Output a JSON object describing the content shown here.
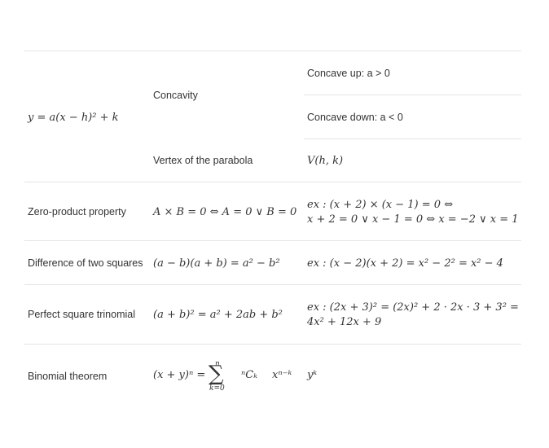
{
  "rows": {
    "vertex_form": {
      "label": "y = a(x − h)² + k",
      "concavity": {
        "label": "Concavity",
        "up": "Concave up: a > 0",
        "down": "Concave down: a < 0"
      },
      "vertex": {
        "label": "Vertex of the parabola",
        "value": "V(h, k)"
      }
    },
    "zero_product": {
      "label": "Zero-product property",
      "formula": "A × B = 0 ⇔ A = 0 ∨ B = 0",
      "example_line1": "ex : (x + 2) × (x − 1) = 0 ⇔",
      "example_line2": "x + 2 = 0 ∨ x − 1 = 0 ⇔ x = −2 ∨ x = 1"
    },
    "difference_squares": {
      "label": "Difference of two squares",
      "formula": "(a − b)(a + b) = a² − b²",
      "example": "ex : (x − 2)(x + 2) = x² − 2² = x² − 4"
    },
    "perfect_square": {
      "label": "Perfect square trinomial",
      "formula": "(a + b)² = a² + 2ab + b²",
      "example_line1": "ex : (2x + 3)² = (2x)² + 2 · 2x · 3 + 3² =",
      "example_line2": "4x² + 12x + 9"
    },
    "binomial": {
      "label": "Binomial theorem",
      "lhs": "(x + y)ⁿ =",
      "sigma": "∑",
      "upper": "n",
      "lower": "k=0",
      "comb": "ⁿCₖ",
      "xpow": "xⁿ⁻ᵏ",
      "ypow": "yᵏ"
    }
  }
}
